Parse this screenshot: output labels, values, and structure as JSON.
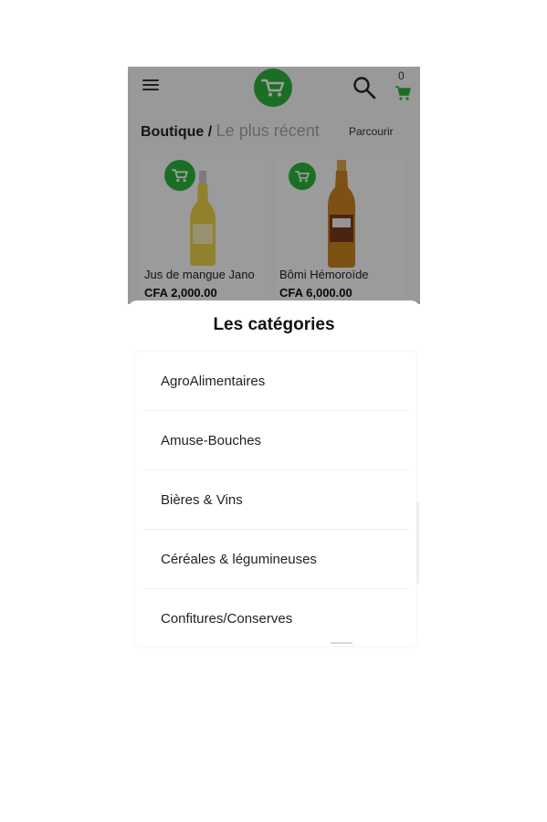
{
  "header": {
    "cart_count": "0"
  },
  "breadcrumb": {
    "shop": "Boutique",
    "separator": " / ",
    "current": "Le plus récent"
  },
  "browse_label": "Parcourir",
  "products": [
    {
      "name": "Jus de mangue Jano",
      "price": "CFA 2,000.00"
    },
    {
      "name": "Bômi Hémoroïde",
      "price": "CFA 6,000.00"
    }
  ],
  "sheet": {
    "title": "Les catégories",
    "categories": [
      "AgroAlimentaires",
      "Amuse-Bouches",
      "Bières & Vins",
      "Céréales & légumineuses",
      "Confitures/Conserves"
    ]
  },
  "icons": {
    "menu": "hamburger-icon",
    "logo": "cart-logo-icon",
    "search": "search-icon",
    "cart": "cart-icon"
  },
  "colors": {
    "brand_green": "#2db33a",
    "muted_text": "#a6a6a6"
  }
}
